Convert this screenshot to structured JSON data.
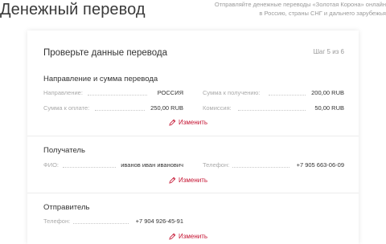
{
  "header": {
    "title": "Денежный перевод",
    "note": "Отправляйте денежные переводы «Золотая Корона» онлайн в Россию, страны СНГ и дальнего зарубежья"
  },
  "card": {
    "title": "Проверьте данные перевода",
    "step": "Шаг 5 из 6"
  },
  "direction": {
    "title": "Направление и сумма перевода",
    "fields": {
      "direction_label": "Направление:",
      "direction_value": "РОССИЯ",
      "receive_label": "Сумма к получению:",
      "receive_value": "200,00 RUB",
      "pay_label": "Сумма к оплате:",
      "pay_value": "250,00 RUB",
      "fee_label": "Комиссия:",
      "fee_value": "50,00 RUB"
    },
    "edit_label": "Изменить"
  },
  "recipient": {
    "title": "Получатель",
    "fields": {
      "name_label": "ФИО:",
      "name_value": "иванов иван иванович",
      "phone_label": "Телефон:",
      "phone_value": "+7 905 663-06-09"
    },
    "edit_label": "Изменить"
  },
  "sender": {
    "title": "Отправитель",
    "fields": {
      "phone_label": "Телефон:",
      "phone_value": "+7 904 926-45-91"
    },
    "edit_label": "Изменить"
  },
  "colors": {
    "accent": "#c41230",
    "muted": "#aaaaaa"
  }
}
